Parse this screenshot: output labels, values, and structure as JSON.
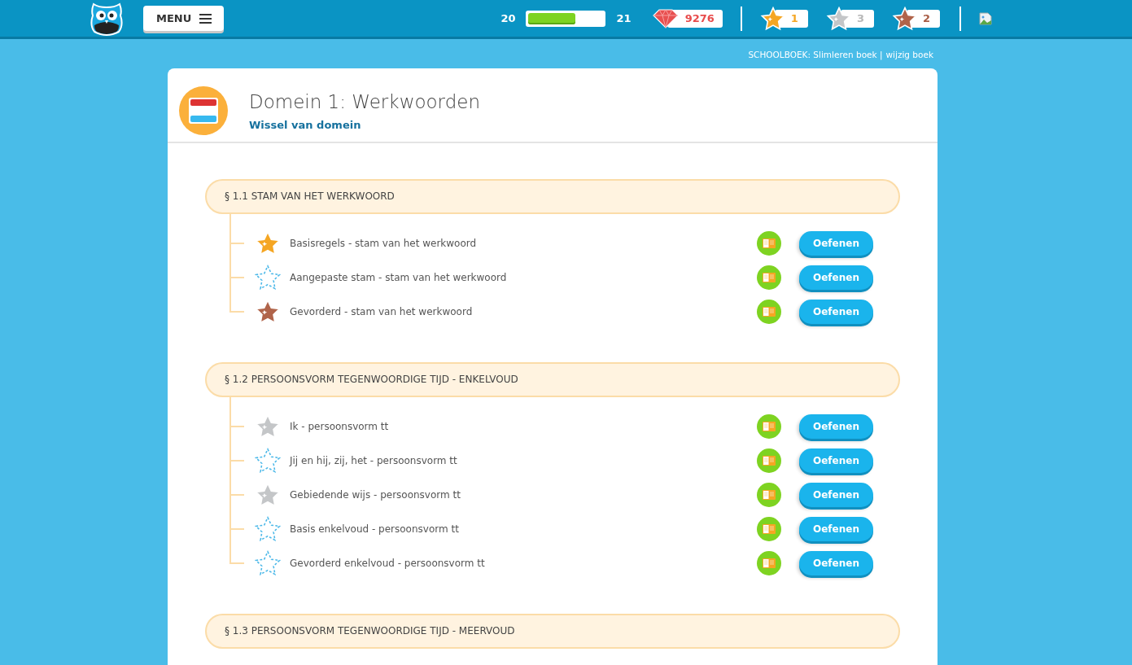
{
  "header": {
    "menu_label": "MENU",
    "level_from": "20",
    "level_to": "21",
    "xp": {
      "level": 0.62
    },
    "gems": "9276",
    "medals": [
      {
        "kind": "gold",
        "count": "1"
      },
      {
        "kind": "silver",
        "count": "3"
      },
      {
        "kind": "bronze",
        "count": "2"
      }
    ]
  },
  "book": {
    "label": "SCHOOLBOEK: Slimleren boek |",
    "link": "wijzig boek"
  },
  "domain": {
    "title": "Domein 1: Werkwoorden",
    "link": "Wissel van domein"
  },
  "sections": [
    {
      "title": "§ 1.1 STAM VAN HET WERKWOORD",
      "lessons": [
        {
          "kind": "gold",
          "name": "Basisregels - stam van het werkwoord",
          "button": "Oefenen"
        },
        {
          "kind": "none",
          "name": "Aangepaste stam - stam van het werkwoord",
          "button": "Oefenen"
        },
        {
          "kind": "bronze",
          "name": "Gevorderd - stam van het werkwoord",
          "button": "Oefenen"
        }
      ]
    },
    {
      "title": "§ 1.2 PERSOONSVORM TEGENWOORDIGE TIJD - ENKELVOUD",
      "lessons": [
        {
          "kind": "silver",
          "name": "Ik - persoonsvorm tt",
          "button": "Oefenen"
        },
        {
          "kind": "none",
          "name": "Jij en hij, zij, het - persoonsvorm tt",
          "button": "Oefenen"
        },
        {
          "kind": "silver",
          "name": "Gebiedende wijs - persoonsvorm tt",
          "button": "Oefenen"
        },
        {
          "kind": "none",
          "name": "Basis enkelvoud - persoonsvorm tt",
          "button": "Oefenen"
        },
        {
          "kind": "none",
          "name": "Gevorderd enkelvoud - persoonsvorm tt",
          "button": "Oefenen"
        }
      ]
    },
    {
      "title": "§ 1.3 PERSOONSVORM TEGENWOORDIGE TIJD - MEERVOUD"
    }
  ]
}
